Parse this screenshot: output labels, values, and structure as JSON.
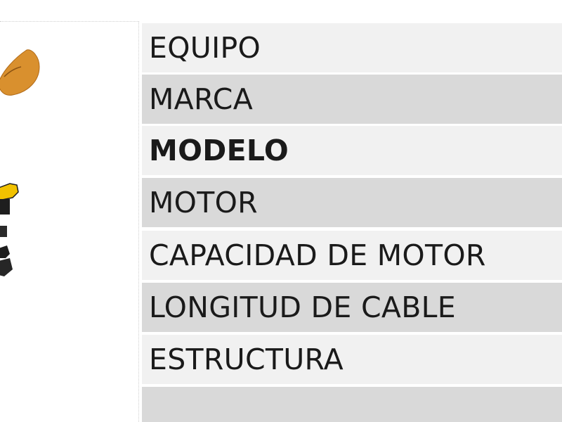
{
  "spec_table": {
    "rows": [
      {
        "label": "EQUIPO"
      },
      {
        "label": "MARCA"
      },
      {
        "label": "MODELO"
      },
      {
        "label": "MOTOR"
      },
      {
        "label": "CAPACIDAD DE MOTOR"
      },
      {
        "label": "LONGITUD DE CABLE"
      },
      {
        "label": "ESTRUCTURA"
      },
      {
        "label": ""
      }
    ]
  },
  "colors": {
    "row_light": "#f1f1f1",
    "row_dark": "#d9d9d9",
    "text": "#1a1a1a",
    "product_orange": "#d9902e",
    "product_yellow": "#f2c200",
    "product_black": "#1e1e1e"
  },
  "product_image": {
    "icon": "equipment-photo-icon"
  }
}
